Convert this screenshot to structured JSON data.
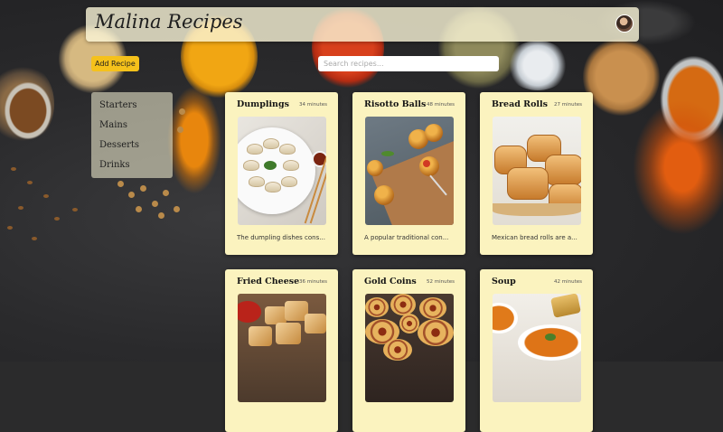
{
  "header": {
    "title": "Malina Recipes"
  },
  "toolbar": {
    "add_label": "Add Recipe",
    "search_placeholder": "Search recipes..."
  },
  "sidebar": {
    "categories": [
      "Starters",
      "Mains",
      "Desserts",
      "Drinks"
    ]
  },
  "recipes": [
    {
      "name": "Dumplings",
      "time": "34 minutes",
      "description": "The dumpling dishes cons..."
    },
    {
      "name": "Risotto Balls",
      "time": "48 minutes",
      "description": "A popular traditional con..."
    },
    {
      "name": "Bread Rolls",
      "time": "27 minutes",
      "description": "Mexican bread rolls are a..."
    },
    {
      "name": "Fried Cheese",
      "time": "36 minutes",
      "description": ""
    },
    {
      "name": "Gold Coins",
      "time": "52 minutes",
      "description": ""
    },
    {
      "name": "Soup",
      "time": "42 minutes",
      "description": ""
    }
  ],
  "colors": {
    "accent": "#f5c11b",
    "card": "#fbf3bf",
    "header": "#faf5d7",
    "background": "#2b2b2c"
  }
}
